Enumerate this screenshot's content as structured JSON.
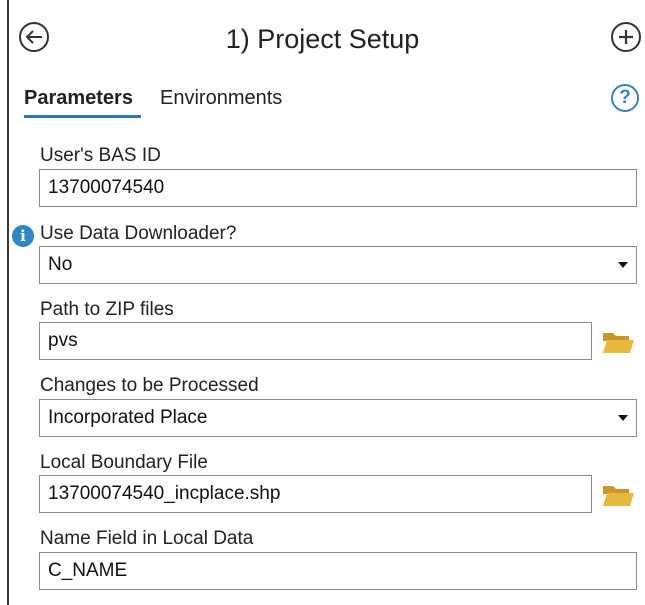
{
  "header": {
    "title": "1) Project Setup",
    "back_icon": "back-arrow-icon",
    "add_icon": "add-circle-icon"
  },
  "tabs": [
    {
      "label": "Parameters",
      "active": true
    },
    {
      "label": "Environments",
      "active": false
    }
  ],
  "help_icon": "?",
  "info_icon": "i",
  "colors": {
    "accent": "#2e7ab8",
    "info": "#2e86c8",
    "folder": "#e3b43a"
  },
  "form": {
    "bas_id": {
      "label": "User's BAS ID",
      "value": "13700074540"
    },
    "use_downloader": {
      "label": "Use Data Downloader?",
      "value": "No"
    },
    "zip_path": {
      "label": "Path to ZIP files",
      "value": "pvs"
    },
    "changes": {
      "label": "Changes to be Processed",
      "value": "Incorporated Place"
    },
    "boundary_file": {
      "label": "Local Boundary File",
      "value": "13700074540_incplace.shp"
    },
    "name_field": {
      "label": "Name Field in Local Data",
      "value": "C_NAME"
    }
  }
}
